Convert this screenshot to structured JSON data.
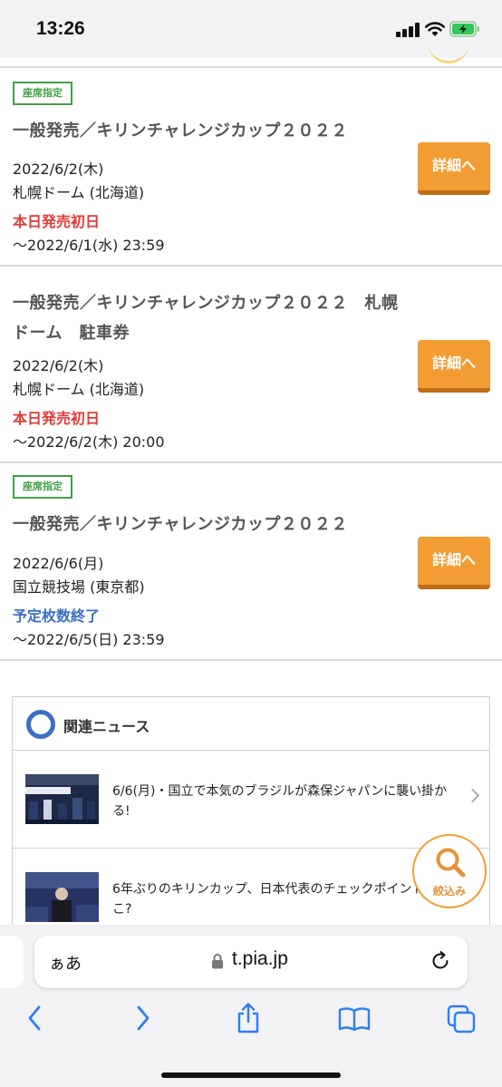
{
  "status_bar": {
    "time": "13:26"
  },
  "tickets": [
    {
      "badge": "座席指定",
      "title": "一般発売／キリンチャレンジカップ２０２２",
      "date": "2022/6/2(木)",
      "venue": "札幌ドーム (北海道)",
      "sale_status": "本日発売初日",
      "deadline": "〜2022/6/1(水) 23:59",
      "button_label": "詳細へ"
    },
    {
      "badge": "",
      "title": "一般発売／キリンチャレンジカップ２０２２　札幌ドーム　駐車券",
      "date": "2022/6/2(木)",
      "venue": "札幌ドーム (北海道)",
      "sale_status": "本日発売初日",
      "deadline": "〜2022/6/2(木) 20:00",
      "button_label": "詳細へ"
    },
    {
      "badge": "座席指定",
      "title": "一般発売／キリンチャレンジカップ２０２２",
      "date": "2022/6/6(月)",
      "venue": "国立競技場 (東京都)",
      "sale_status": "予定枚数終了",
      "deadline": "〜2022/6/5(日) 23:59",
      "button_label": "詳細へ"
    }
  ],
  "news": {
    "heading": "関連ニュース",
    "items": [
      {
        "text": "6/6(月)・国立で本気のブラジルが森保ジャパンに襲い掛かる!"
      },
      {
        "text": "6年ぶりのキリンカップ、日本代表のチェックポイントはどこ?"
      }
    ]
  },
  "filter_button": {
    "label": "絞込み"
  },
  "browser": {
    "aa_label": "ぁあ",
    "url": "t.pia.jp"
  },
  "colors": {
    "accent_orange": "#f29d33",
    "badge_green": "#43a047",
    "status_red": "#e53935",
    "status_blue": "#3a6fc4",
    "ios_blue": "#2f7cf6"
  }
}
